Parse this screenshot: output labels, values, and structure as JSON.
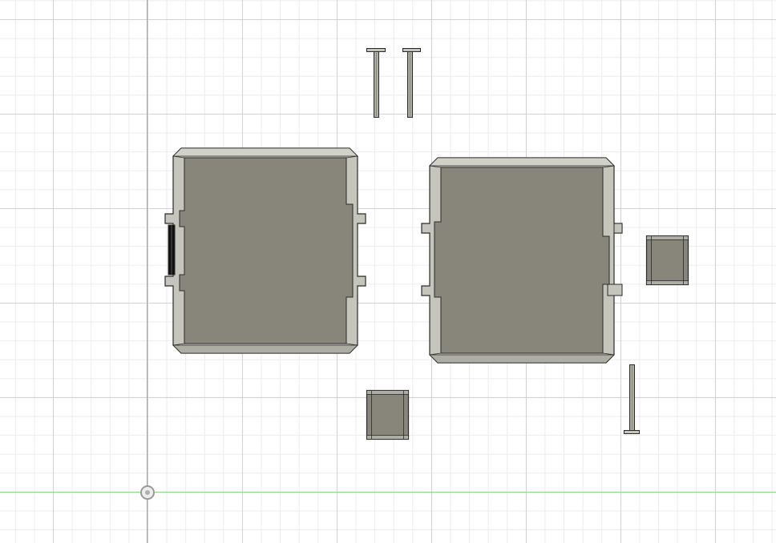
{
  "canvas": {
    "grid": true,
    "x_axis_color": "#8fd88f",
    "y_axis_color": "#e88a8a"
  },
  "colors": {
    "body_fill": "#88857b",
    "bevel_light": "#c6c5bc",
    "bevel_mid": "#aeada4",
    "edge": "#2a2a2a",
    "hinge_slot": "#111111"
  },
  "parts": [
    {
      "name": "pin-1",
      "kind": "pin"
    },
    {
      "name": "pin-2",
      "kind": "pin"
    },
    {
      "name": "left-panel",
      "kind": "panel"
    },
    {
      "name": "right-panel",
      "kind": "panel"
    },
    {
      "name": "hinge-block-1",
      "kind": "block"
    },
    {
      "name": "hinge-block-2",
      "kind": "block"
    },
    {
      "name": "pin-3",
      "kind": "pin"
    }
  ]
}
